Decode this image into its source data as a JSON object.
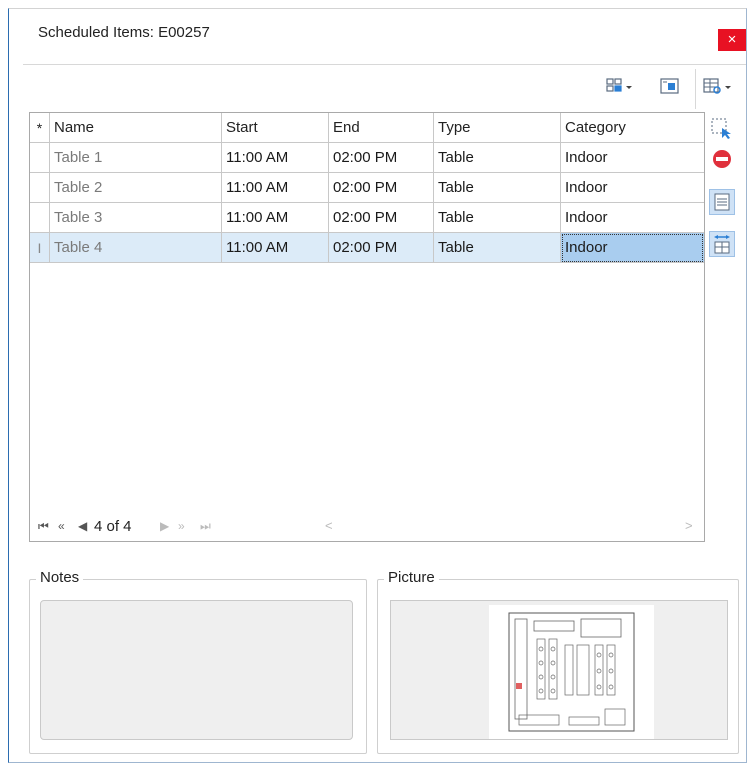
{
  "window": {
    "title": "Scheduled Items:  E00257",
    "close_label": "×"
  },
  "toolbar": {
    "icons": [
      "layout-grid-icon",
      "form-view-icon",
      "column-chooser-icon"
    ]
  },
  "grid": {
    "new_row_marker": "*",
    "columns": [
      "Name",
      "Start",
      "End",
      "Type",
      "Category"
    ],
    "rows": [
      {
        "indicator": "",
        "name": "Table 1",
        "start": "11:00 AM",
        "end": "02:00 PM",
        "type": "Table",
        "category": "Indoor"
      },
      {
        "indicator": "",
        "name": "Table 2",
        "start": "11:00 AM",
        "end": "02:00 PM",
        "type": "Table",
        "category": "Indoor"
      },
      {
        "indicator": "",
        "name": "Table 3",
        "start": "11:00 AM",
        "end": "02:00 PM",
        "type": "Table",
        "category": "Indoor"
      },
      {
        "indicator": "I",
        "name": "Table 4",
        "start": "11:00 AM",
        "end": "02:00 PM",
        "type": "Table",
        "category": "Indoor"
      }
    ],
    "selected_row": 4
  },
  "navigator": {
    "first": "⏮",
    "prev_page": "«",
    "prev": "◀",
    "position": "4 of 4",
    "next": "▶",
    "next_page": "»",
    "last": "⏭",
    "scroll_left": "<",
    "scroll_right": ">"
  },
  "side_toolbar": {
    "icons": [
      "select-icon",
      "delete-icon",
      "details-icon",
      "expand-grid-icon"
    ]
  },
  "notes": {
    "label": "Notes"
  },
  "picture": {
    "label": "Picture",
    "image": "floor-plan"
  },
  "colors": {
    "close": "#e81123",
    "selected_row": "#dcebf8",
    "selected_cell": "#a9cdef",
    "accent_border": "#2b6cb0"
  }
}
